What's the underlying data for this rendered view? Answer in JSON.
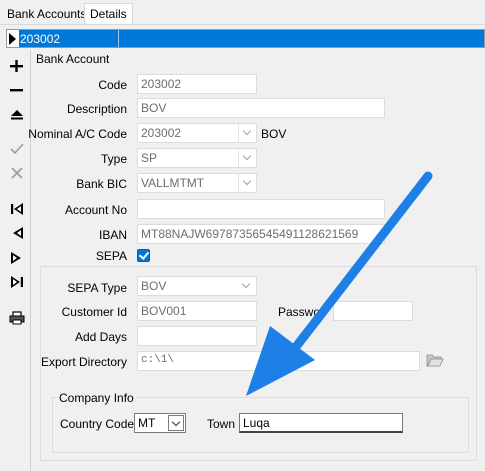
{
  "tabs": [
    {
      "label": "Bank Accounts",
      "active": false
    },
    {
      "label": "Details",
      "active": true
    }
  ],
  "record_bar": {
    "value": "203002"
  },
  "toolbar": {
    "icons": [
      "plus-icon",
      "minus-icon",
      "eject-icon",
      "check-icon",
      "cross-icon",
      "first-record-icon",
      "previous-record-icon",
      "next-record-icon",
      "last-record-icon",
      "print-icon"
    ]
  },
  "bank_account": {
    "group_title": "Bank Account",
    "code_label": "Code",
    "code_value": "203002",
    "description_label": "Description",
    "description_value": "BOV",
    "nominal_label": "Nominal A/C Code",
    "nominal_value": "203002",
    "nominal_name": "BOV",
    "type_label": "Type",
    "type_value": "SP",
    "bic_label": "Bank BIC",
    "bic_value": "VALLMTMT",
    "account_no_label": "Account No",
    "account_no_value": "",
    "iban_label": "IBAN",
    "iban_value": "MT88NAJW69787356545491128621569",
    "sepa_label": "SEPA",
    "sepa_checked": true
  },
  "sepa": {
    "type_label": "SEPA Type",
    "type_value": "BOV",
    "customer_id_label": "Customer Id",
    "customer_id_value": "BOV001",
    "password_label": "Passwo",
    "password_value": "",
    "add_days_label": "Add Days",
    "add_days_value": "",
    "export_dir_label": "Export Directory",
    "export_dir_value": "c:\\1\\"
  },
  "company_info": {
    "group_title": "Company Info",
    "country_label": "Country Code",
    "country_value": "MT",
    "town_label": "Town",
    "town_value": "Luqa"
  },
  "colors": {
    "accent": "#0078d7",
    "arrow": "#1e7fe6"
  }
}
